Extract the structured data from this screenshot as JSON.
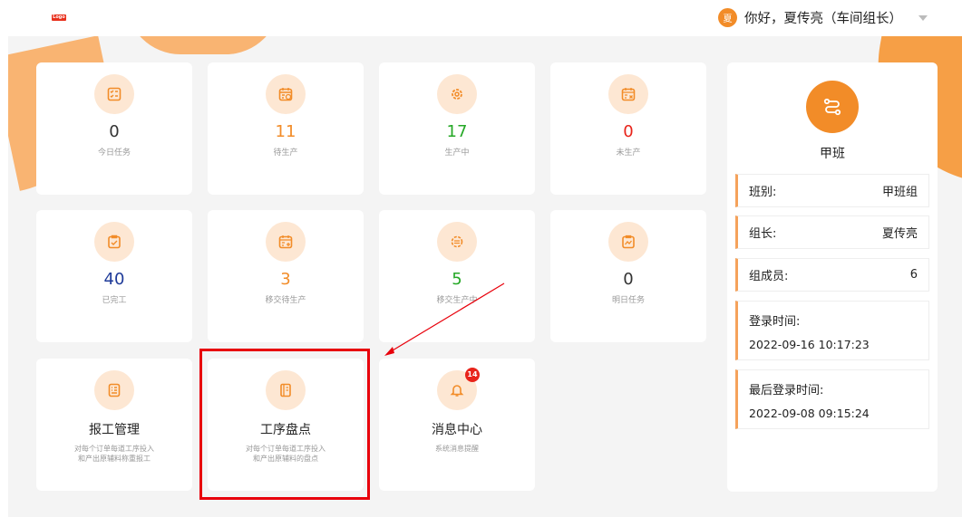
{
  "header": {
    "logo_text": "Logo",
    "user_avatar": "夏",
    "greeting": "你好，夏传亮（车间组长）"
  },
  "stats": [
    {
      "value": "0",
      "label": "今日任务",
      "color": "#333333",
      "icon": "task-list-icon"
    },
    {
      "value": "11",
      "label": "待生产",
      "color": "#f28c28",
      "icon": "calendar-clock-icon"
    },
    {
      "value": "17",
      "label": "生产中",
      "color": "#25a826",
      "icon": "gear-icon"
    },
    {
      "value": "0",
      "label": "未生产",
      "color": "#e8231a",
      "icon": "calendar-cancel-icon"
    },
    {
      "value": "40",
      "label": "已完工",
      "color": "#1f3b99",
      "icon": "clipboard-check-icon"
    },
    {
      "value": "3",
      "label": "移交待生产",
      "color": "#f28c28",
      "icon": "calendar-transfer-icon"
    },
    {
      "value": "5",
      "label": "移交生产中",
      "color": "#25a826",
      "icon": "gear-transfer-icon"
    },
    {
      "value": "0",
      "label": "明日任务",
      "color": "#333333",
      "icon": "clipboard-chart-icon"
    }
  ],
  "functions": [
    {
      "title": "报工管理",
      "desc": [
        "对每个订单每道工序投入",
        "和产出原辅料称重报工"
      ],
      "icon": "report-document-icon"
    },
    {
      "title": "工序盘点",
      "desc": [
        "对每个订单每道工序投入",
        "和产出原辅料的盘点"
      ],
      "icon": "inventory-book-icon"
    },
    {
      "title": "消息中心",
      "desc": [
        "系统消息提醒"
      ],
      "icon": "bell-icon",
      "badge": "14"
    }
  ],
  "panel": {
    "title": "甲班",
    "rows": [
      {
        "label": "班别:",
        "value": "甲班组"
      },
      {
        "label": "组长:",
        "value": "夏传亮"
      },
      {
        "label": "组成员:",
        "value": "6"
      },
      {
        "label": "登录时间:",
        "value": "2022-09-16 10:17:23"
      },
      {
        "label": "最后登录时间:",
        "value": "2022-09-08 09:15:24"
      }
    ]
  },
  "colors": {
    "accent": "#f28c28",
    "highlight": "#e8000b"
  }
}
